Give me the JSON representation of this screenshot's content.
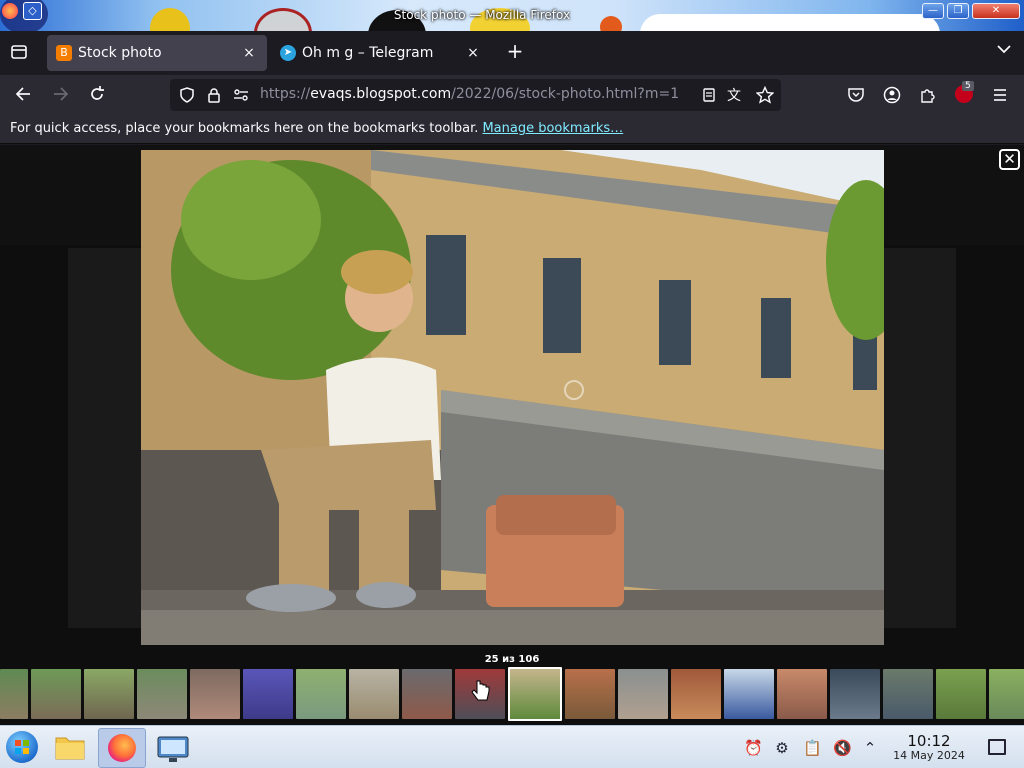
{
  "window": {
    "title": "Stock photo — Mozilla Firefox",
    "buttons": {
      "minimize": "—",
      "maximize": "❐",
      "close": "✕"
    }
  },
  "tabs": [
    {
      "label": "Stock photo",
      "favicon": "blogger-icon",
      "active": true,
      "color": "#f57d00"
    },
    {
      "label": "Oh m g – Telegram",
      "favicon": "telegram-icon",
      "active": false,
      "color": "#2aa3de"
    }
  ],
  "tabstrip": {
    "new_tab": "+",
    "close": "×"
  },
  "navbar": {
    "url_prefix": "https://",
    "url_host": "evaqs.blogspot.com",
    "url_path": "/2022/06/stock-photo.html?m=1",
    "extension_badge": "5"
  },
  "bookmarks_bar": {
    "message": "For quick access, place your bookmarks here on the bookmarks toolbar.",
    "link": "Manage bookmarks…"
  },
  "lightbox": {
    "counter": "25 из 106",
    "close": "✕",
    "current_index": 25,
    "total": 106
  },
  "clock": {
    "time": "10:12",
    "date": "14 May 2024"
  },
  "colors": {
    "accent": "#0060df",
    "link": "#80ebff",
    "tab_active": "#42414d",
    "chrome": "#2b2a33"
  }
}
